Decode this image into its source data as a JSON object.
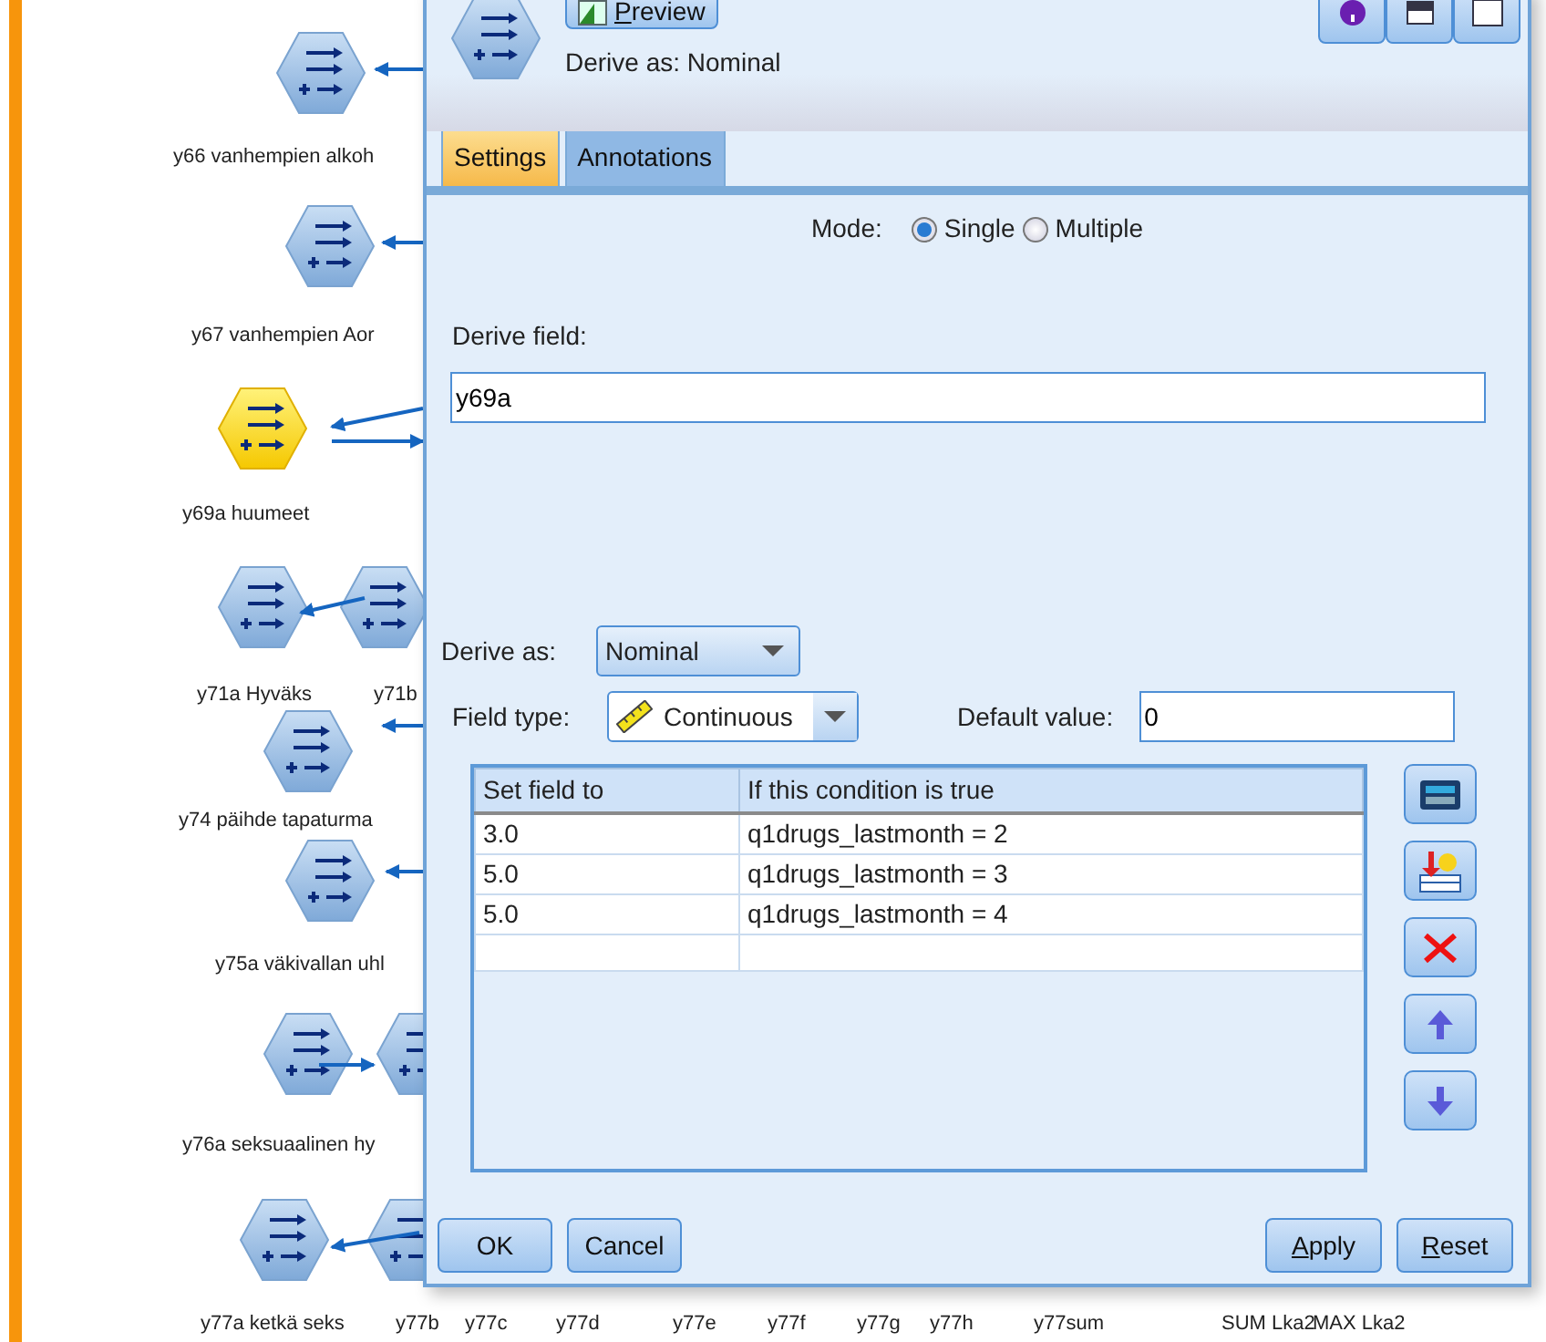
{
  "canvas": {
    "nodes": [
      {
        "label": "y66 vanhempien alkoh",
        "selected": false
      },
      {
        "label": "y67 vanhempien Aor",
        "selected": false
      },
      {
        "label": "y69a huumeet",
        "selected": true
      },
      {
        "label": "y71a Hyväks",
        "selected": false
      },
      {
        "label": "y71b",
        "selected": false
      },
      {
        "label": "y74 päihde tapaturma",
        "selected": false
      },
      {
        "label": "y75a väkivallan uhl",
        "selected": false
      },
      {
        "label": "y76a seksuaalinen hy",
        "selected": false
      },
      {
        "selected": false
      },
      {
        "label": "y77a ketkä seks",
        "selected": false
      },
      {
        "label": "y77b",
        "selected": false
      }
    ],
    "bottom_labels": [
      "y77c",
      "y77d",
      "y77e",
      "y77f",
      "y77g",
      "y77h",
      "y77sum",
      "SUM Lka2",
      "MAX Lka2"
    ]
  },
  "dialog": {
    "preview_button": {
      "label": "Preview",
      "mnemonic": true
    },
    "subtitle": "Derive as: Nominal",
    "tabs": [
      {
        "label": "Settings",
        "selected": true
      },
      {
        "label": "Annotations",
        "selected": false
      }
    ],
    "mode": {
      "label": "Mode:",
      "options": [
        {
          "label": "Single",
          "selected": true
        },
        {
          "label": "Multiple",
          "selected": false
        }
      ]
    },
    "derive_field": {
      "label": "Derive field:",
      "value": "y69a"
    },
    "derive_as": {
      "label": "Derive as:",
      "value": "Nominal"
    },
    "field_type": {
      "label": "Field type:",
      "value": "Continuous"
    },
    "default_value": {
      "label": "Default value:",
      "value": "0"
    },
    "table": {
      "columns": [
        "Set field to",
        "If this condition is true"
      ],
      "rows": [
        [
          "3.0",
          "q1drugs_lastmonth = 2"
        ],
        [
          "5.0",
          "q1drugs_lastmonth = 3"
        ],
        [
          "5.0",
          "q1drugs_lastmonth = 4"
        ]
      ]
    },
    "buttons_left": [
      {
        "label": "OK",
        "mnemonic": false
      },
      {
        "label": "Cancel",
        "mnemonic": false
      }
    ],
    "buttons_right": [
      {
        "label": "Apply",
        "mnemonic": true
      },
      {
        "label": "Reset",
        "mnemonic": true
      }
    ]
  }
}
